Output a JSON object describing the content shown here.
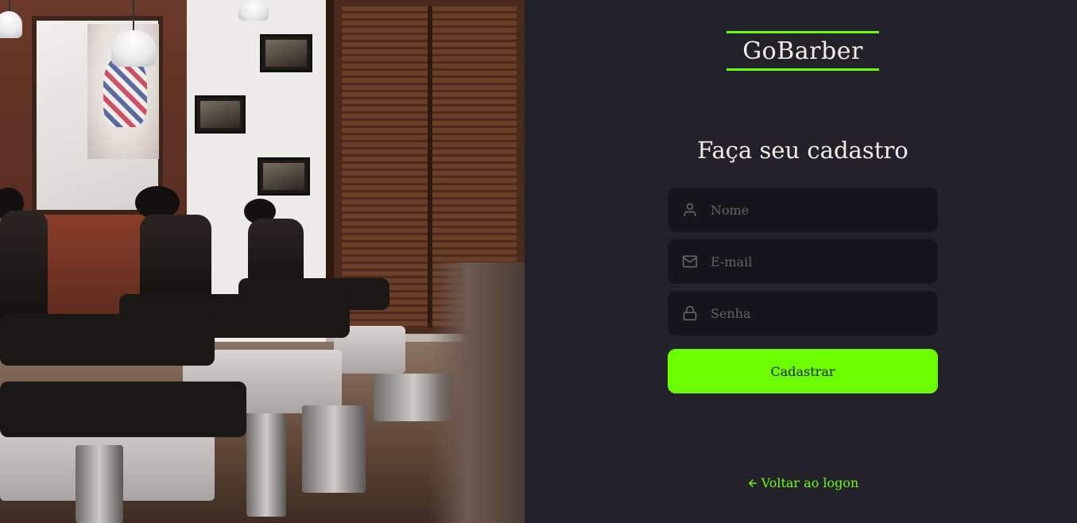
{
  "brand": {
    "logo_text": "GoBarber",
    "accent_color": "#6cfc00",
    "background_color": "#232129",
    "input_background": "#17151c"
  },
  "hero": {
    "image_description_icon": "barbershop-interior-image"
  },
  "form": {
    "title": "Faça seu cadastro",
    "fields": [
      {
        "name": "name",
        "icon": "user-icon",
        "placeholder": "Nome",
        "value": ""
      },
      {
        "name": "email",
        "icon": "mail-icon",
        "placeholder": "E-mail",
        "value": ""
      },
      {
        "name": "password",
        "icon": "lock-icon",
        "placeholder": "Senha",
        "value": ""
      }
    ],
    "submit_label": "Cadastrar"
  },
  "footer": {
    "back_link_icon": "arrow-left-icon",
    "back_link_label": "Voltar ao logon"
  }
}
